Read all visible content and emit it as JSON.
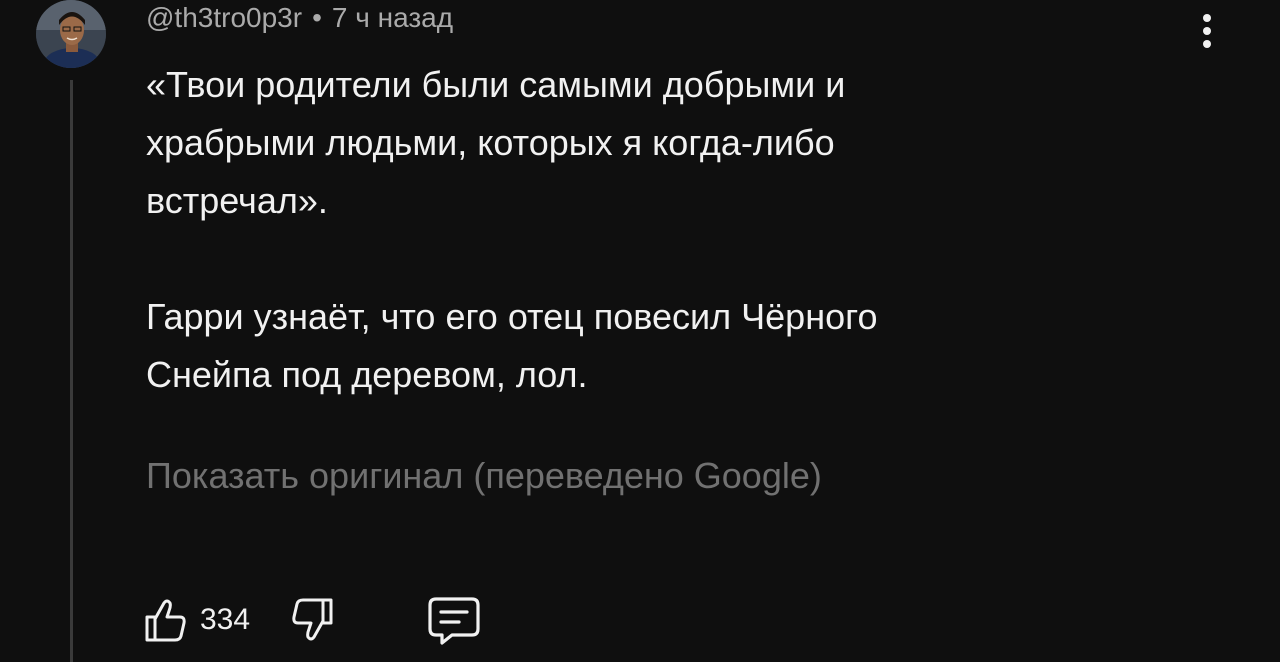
{
  "comment": {
    "author": "@th3tro0p3r",
    "separator": "•",
    "time": "7 ч назад",
    "text_lines": [
      "«Твои родители были самыми добрыми и",
      "храбрыми людьми, которых я когда-либо",
      "встречал».",
      "Гарри узнаёт, что его отец повесил Чёрного",
      "Снейпа под деревом, лол."
    ],
    "translate_label": "Показать оригинал (переведено Google)",
    "like_count": "334"
  },
  "icons": {
    "avatar": "user-avatar",
    "more": "more-vertical-icon",
    "like": "thumbs-up-icon",
    "dislike": "thumbs-down-icon",
    "reply": "comment-reply-icon"
  },
  "colors": {
    "background": "#0f0f0f",
    "text": "#f1f1f1",
    "meta": "#aaaaaa",
    "muted": "#717171"
  }
}
